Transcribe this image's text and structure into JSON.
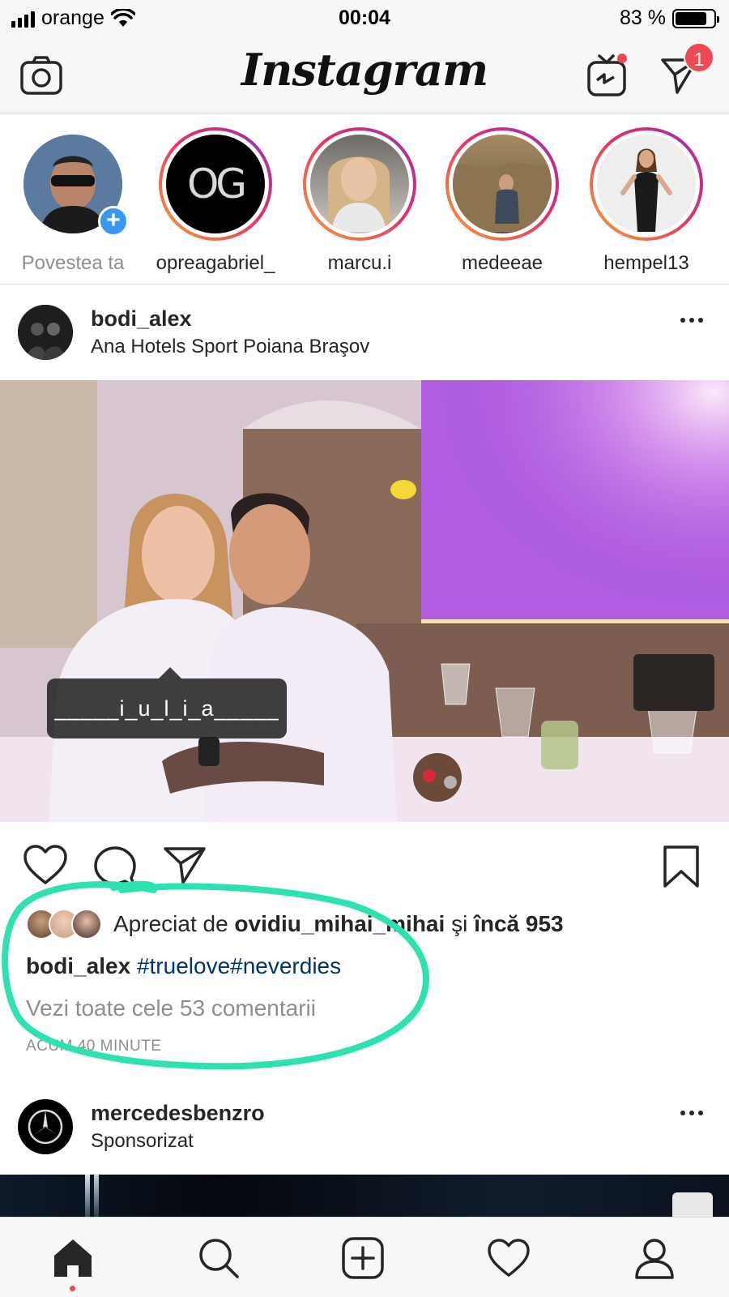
{
  "status_bar": {
    "carrier": "orange",
    "time": "00:04",
    "battery_percent": "83 %",
    "battery_level": 0.83
  },
  "header": {
    "logo": "Instagram",
    "left_icon": "camera-icon",
    "right_icons": [
      "igtv-icon",
      "direct-message-icon"
    ],
    "direct_badge": "1"
  },
  "stories": [
    {
      "label": "Povestea ta",
      "own": true
    },
    {
      "label": "opreagabriel_",
      "avatar_text": "OG"
    },
    {
      "label": "marcu.i"
    },
    {
      "label": "medeeae"
    },
    {
      "label": "hempel13"
    }
  ],
  "post": {
    "username": "bodi_alex",
    "location": "Ana Hotels Sport Poiana Braşov",
    "photo_tag": "_____i_u_l_i_a_____",
    "likes": {
      "prefix": "Apreciat de",
      "user": "ovidiu_mihai_mihai",
      "conjunction": "şi",
      "others": "încă 953"
    },
    "caption_user": "bodi_alex",
    "caption_text": "#truelove#neverdies",
    "comments_link": "Vezi toate cele 53 comentarii",
    "timestamp": "ACUM 40 MINUTE",
    "highlight_color": "#2de2b0"
  },
  "post2": {
    "username": "mercedesbenzro",
    "subtitle": "Sponsorizat"
  },
  "tabbar": {
    "tabs": [
      "home-icon",
      "search-icon",
      "add-post-icon",
      "activity-heart-icon",
      "profile-icon"
    ]
  },
  "colors": {
    "accent_blue": "#3897f0",
    "badge_red": "#ed4956",
    "hashtag_blue": "#003569"
  }
}
